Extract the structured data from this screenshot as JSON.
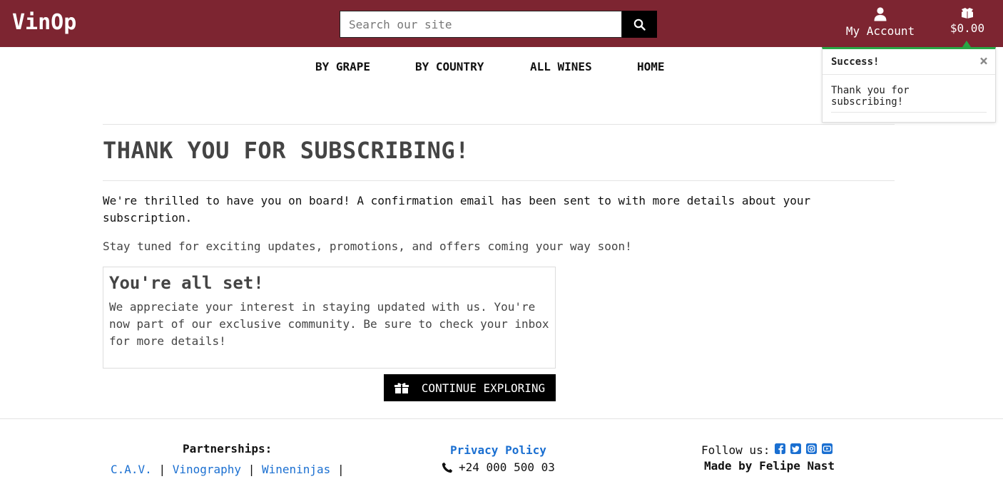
{
  "header": {
    "logo": "VinOp",
    "search_placeholder": "Search our site",
    "account_label": "My Account",
    "cart_total": "$0.00"
  },
  "nav": {
    "items": [
      "BY GRAPE",
      "BY COUNTRY",
      "ALL WINES",
      "HOME"
    ]
  },
  "toast": {
    "title": "Success!",
    "message": "Thank you for subscribing!",
    "close_glyph": "×"
  },
  "main": {
    "title": "THANK YOU FOR SUBSCRIBING!",
    "paragraph1": "We're thrilled to have you on board! A confirmation email has been sent to with more details about your subscription.",
    "paragraph2": "Stay tuned for exciting updates, promotions, and offers coming your way soon!",
    "card_title": "You're all set!",
    "card_text": "We appreciate your interest in staying updated with us. You're now part of our exclusive community. Be sure to check your inbox for more details!",
    "cta_label": "CONTINUE EXPLORING"
  },
  "footer": {
    "partnerships_label": "Partnerships:",
    "partners": [
      "C.A.V.",
      "Vinography",
      "Wineninjas"
    ],
    "separator": "|",
    "privacy_label": "Privacy Policy",
    "phone": "+24 000 500 03",
    "follow_label": "Follow us:",
    "social_icons": [
      "facebook-icon",
      "twitter-icon",
      "instagram-icon",
      "youtube-icon"
    ],
    "made_by": "Made by Felipe Nast"
  },
  "colors": {
    "brand": "#7d2531",
    "success": "#28a745",
    "link": "#1a6fd1"
  }
}
